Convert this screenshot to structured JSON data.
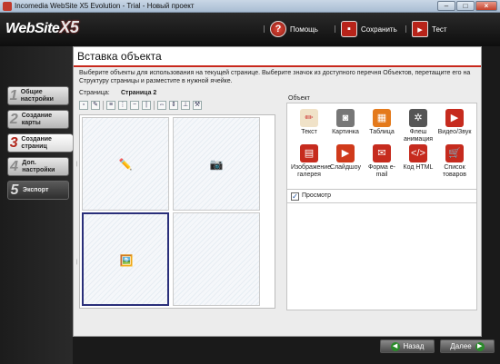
{
  "window": {
    "title": "Incomedia WebSite X5 Evolution - Trial - Новый проект"
  },
  "header": {
    "logo_text": "WebSite",
    "logo_suffix": "X5",
    "help_label": "Помощь",
    "save_label": "Сохранить",
    "test_label": "Тест"
  },
  "nav": {
    "steps": [
      {
        "num": "1",
        "label": "Общие настройки"
      },
      {
        "num": "2",
        "label": "Создание карты"
      },
      {
        "num": "3",
        "label": "Создание страниц"
      },
      {
        "num": "4",
        "label": "Доп. настройки"
      },
      {
        "num": "5",
        "label": "Экспорт"
      }
    ]
  },
  "main": {
    "title": "Вставка объекта",
    "instructions": "Выберите объекты для использования на текущей странице. Выберите значок из доступного перечня Объектов, перетащите его на Структуру страницы и разместите в нужной ячейке.",
    "page_label": "Страница:",
    "page_value": "Страница 2",
    "objects_label": "Объект",
    "objects": [
      {
        "label": "Текст",
        "icon": "text-icon"
      },
      {
        "label": "Картинка",
        "icon": "image-icon"
      },
      {
        "label": "Таблица",
        "icon": "table-icon"
      },
      {
        "label": "Флеш анимация",
        "icon": "flash-icon"
      },
      {
        "label": "Видео/Звук",
        "icon": "video-icon"
      },
      {
        "label": "Изображение галерея",
        "icon": "gallery-icon"
      },
      {
        "label": "Слайдшоу",
        "icon": "slideshow-icon"
      },
      {
        "label": "Форма e-mail",
        "icon": "email-form-icon"
      },
      {
        "label": "Код HTML",
        "icon": "html-code-icon"
      },
      {
        "label": "Список товаров",
        "icon": "product-list-icon"
      }
    ],
    "preview_label": "Просмотр",
    "preview_checked": true
  },
  "footer": {
    "back_label": "Назад",
    "next_label": "Далее"
  }
}
